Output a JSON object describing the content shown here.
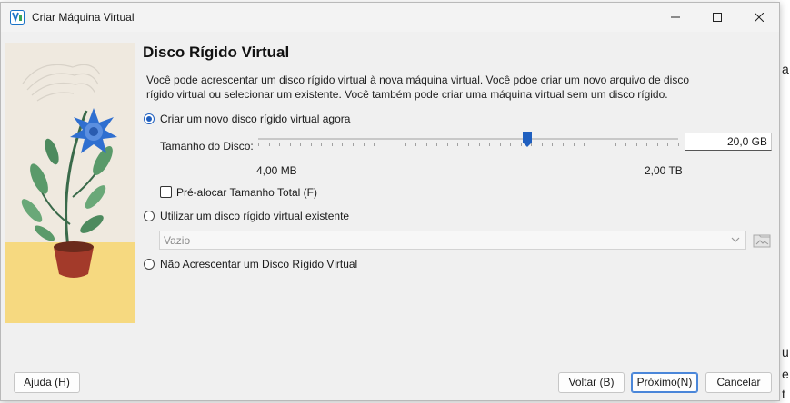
{
  "window": {
    "title": "Criar Máquina Virtual"
  },
  "page": {
    "heading": "Disco Rígido Virtual",
    "description": "Você pode acrescentar um disco rígido virtual à nova máquina virtual. Você pdoe criar um novo arquivo de disco rígido virtual ou selecionar um existente. Você também pode criar uma máquina virtual sem um disco rígido."
  },
  "options": {
    "create_new": {
      "label": "Criar um novo disco rígido virtual agora",
      "selected": true
    },
    "use_existing": {
      "label": "Utilizar um disco rígido virtual existente",
      "selected": false
    },
    "no_disk": {
      "label": "Não Acrescentar um Disco Rígido Virtual",
      "selected": false
    }
  },
  "disk_size": {
    "label": "Tamanho do Disco:",
    "value": "20,0 GB",
    "min_label": "4,00 MB",
    "max_label": "2,00 TB",
    "slider_fraction": 0.64
  },
  "preallocate": {
    "label": "Pré-alocar Tamanho Total (F)",
    "checked": false
  },
  "existing_disk": {
    "selected": "Vazio"
  },
  "buttons": {
    "help": "Ajuda (H)",
    "back": "Voltar (B)",
    "next": "Próximo(N)",
    "cancel": "Cancelar"
  },
  "colors": {
    "accent": "#1f5fbf",
    "dialog_bg": "#f0f0f0"
  }
}
